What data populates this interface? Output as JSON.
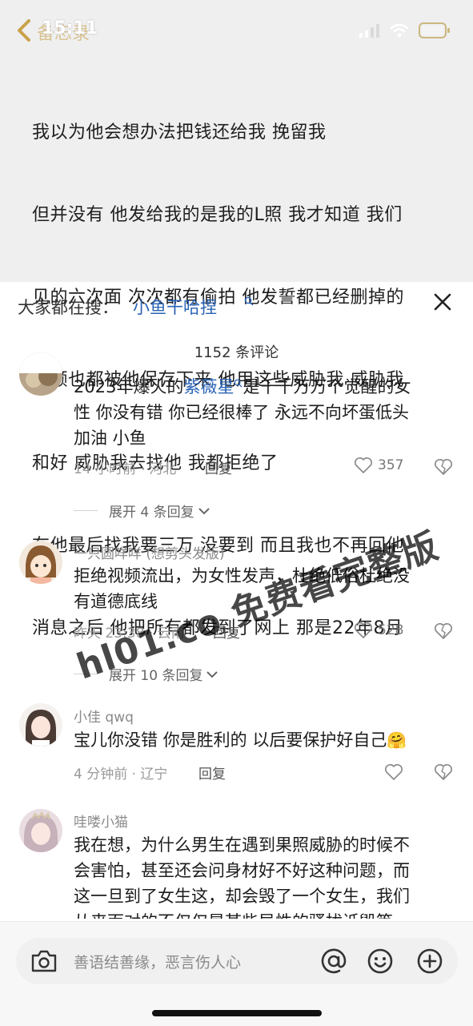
{
  "status": {
    "time": "15:11",
    "back_label": "备忘录"
  },
  "note": {
    "lines": [
      "我以为他会想办法把钱还给我 挽留我",
      "但并没有 他发给我的是我的L照 我才知道 我们",
      "见的六次面 次次都有偷拍 他发誓都已经删掉的",
      "视频也都被他保存下来 他用这些威胁我 威胁我",
      "和好 威胁我去找他 我都拒绝了",
      "在他最后找我要三万 没要到 而且我也不再回他",
      "消息之后 他把所有都发到了网上 那是22年8月"
    ]
  },
  "search": {
    "prefix": "大家都在搜：",
    "term": "小鱼干哈捏"
  },
  "comment_count": "1152 条评论",
  "comments": [
    {
      "text_pre": "2023年爆火的",
      "text_link": "紫薇星",
      "text_post_line1": "是千千万万个觉醒的女",
      "text_line2": "性 你没有错 你已经很棒了 永远不向坏蛋低头",
      "text_line3": "加油 小鱼",
      "meta": "14 小时前 · 河北",
      "reply": "回复",
      "likes": "357",
      "expand": "展开 4 条回复"
    },
    {
      "username": "一只圆咩咩 (想剪头发版)",
      "text_line1": "拒绝视频流出，为女性发声，杜绝低俗杜绝没",
      "text_line2": "有道德底线",
      "meta": "昨天 23:38 · 云南",
      "reply": "回复",
      "likes": "528",
      "expand": "展开 10 条回复"
    },
    {
      "username": "小佳 qwq",
      "text_line1": "宝儿你没错 你是胜利的 以后要保护好自己",
      "meta": "4 分钟前 · 辽宁",
      "reply": "回复"
    },
    {
      "username": "哇喽小猫",
      "text_line1": "我在想，为什么男生在遇到果照威胁的时候不",
      "text_line2": "会害怕，甚至还会问身材好不好这种问题，而",
      "text_line3": "这一旦到了女生这，却会毁了一个女生，我们",
      "text_line4": "从来面对的不仅仅是某些异性的骚扰诋毁等，"
    }
  ],
  "watermark": "hl01.co 免费看完整版",
  "input": {
    "placeholder": "善语结善缘，恶言伤人心"
  },
  "colors": {
    "link": "#2a63b6",
    "note_bg": "#efefef"
  },
  "icons": [
    "back-chevron-icon",
    "signal-icon",
    "wifi-icon",
    "battery-icon",
    "search-icon",
    "close-icon",
    "heart-icon",
    "dislike-heart-icon",
    "chevron-down-icon",
    "camera-icon",
    "at-icon",
    "emoji-icon",
    "plus-icon"
  ]
}
